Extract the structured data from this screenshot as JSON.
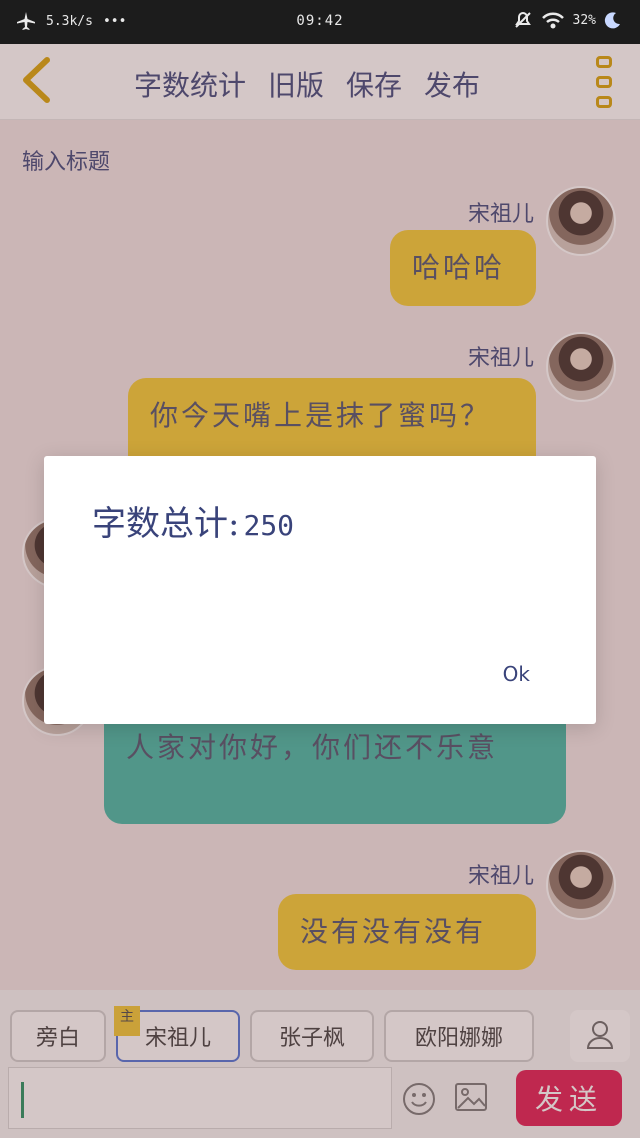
{
  "status_bar": {
    "net_speed": "5.3k/s",
    "more": "•••",
    "time": "09:42",
    "battery": "32%"
  },
  "nav": {
    "actions": [
      "字数统计",
      "旧版",
      "保存",
      "发布"
    ]
  },
  "title_placeholder": "输入标题",
  "messages": [
    {
      "speaker": "宋祖儿",
      "text": "哈哈哈",
      "color": "#f3cc2e"
    },
    {
      "speaker": "宋祖儿",
      "text": "你今天嘴上是抹了蜜吗？",
      "color": "#f3cc2e"
    },
    {
      "speaker": "",
      "text": "人家对你好，你们还不乐意",
      "color": "#3fb7a4"
    },
    {
      "speaker": "宋祖儿",
      "text": "没有没有没有",
      "color": "#f3cc2e"
    }
  ],
  "dialog": {
    "label": "字数总计:",
    "count": "250",
    "ok": "Ok"
  },
  "roles": [
    {
      "label": "旁白",
      "badge": ""
    },
    {
      "label": "宋祖儿",
      "badge": "主"
    },
    {
      "label": "张子枫",
      "badge": ""
    },
    {
      "label": "欧阳娜娜",
      "badge": ""
    }
  ],
  "composer": {
    "send_label": "发送"
  },
  "colors": {
    "accent_yellow": "#f3cc2e",
    "accent_teal": "#3fb7a4",
    "send_button": "#e1164f",
    "menu_icon": "#d8a200"
  }
}
